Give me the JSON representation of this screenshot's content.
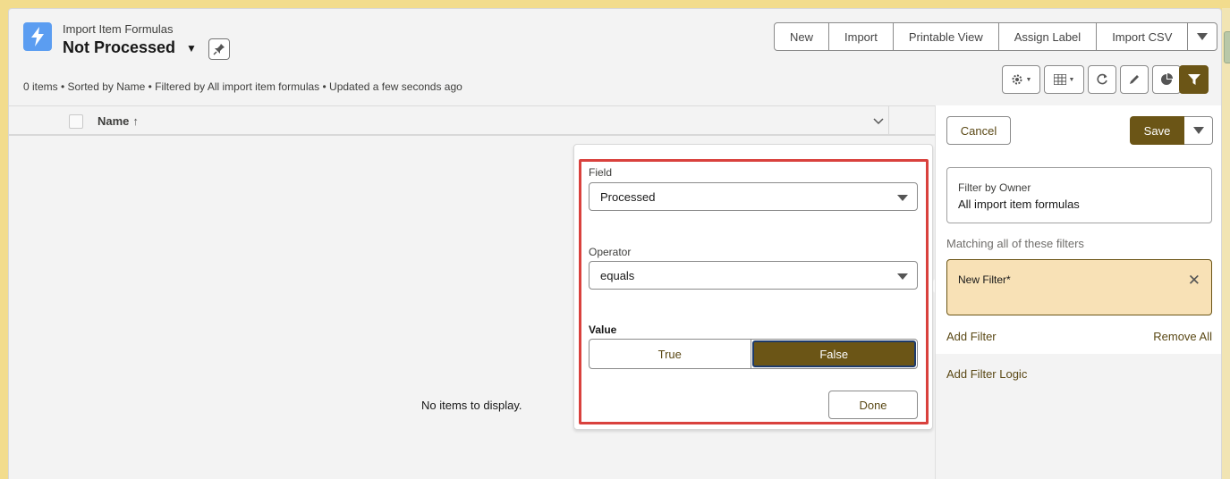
{
  "header": {
    "object_title": "Import Item Formulas",
    "list_title": "Not Processed",
    "meta": "0 items • Sorted by Name • Filtered by All import item formulas • Updated a few seconds ago"
  },
  "actions": [
    {
      "label": "New"
    },
    {
      "label": "Import"
    },
    {
      "label": "Printable View"
    },
    {
      "label": "Assign Label"
    },
    {
      "label": "Import CSV"
    }
  ],
  "table": {
    "column_name": "Name",
    "sort_arrow": "↑",
    "empty_message": "No items to display."
  },
  "filter_editor": {
    "field_label": "Field",
    "field_value": "Processed",
    "operator_label": "Operator",
    "operator_value": "equals",
    "value_label": "Value",
    "options": [
      "True",
      "False"
    ],
    "selected": "False",
    "done_label": "Done"
  },
  "filter_panel": {
    "cancel_label": "Cancel",
    "save_label": "Save",
    "owner_label": "Filter by Owner",
    "owner_value": "All import item formulas",
    "matching_label": "Matching all of these filters",
    "new_filter_label": "New Filter*",
    "add_filter_label": "Add Filter",
    "remove_all_label": "Remove All",
    "add_logic_label": "Add Filter Logic"
  },
  "colors": {
    "brand": "#6b5516",
    "highlight": "#d9413d",
    "icon_blue": "#5b9df1",
    "filter_bg": "#f8e1b6"
  }
}
